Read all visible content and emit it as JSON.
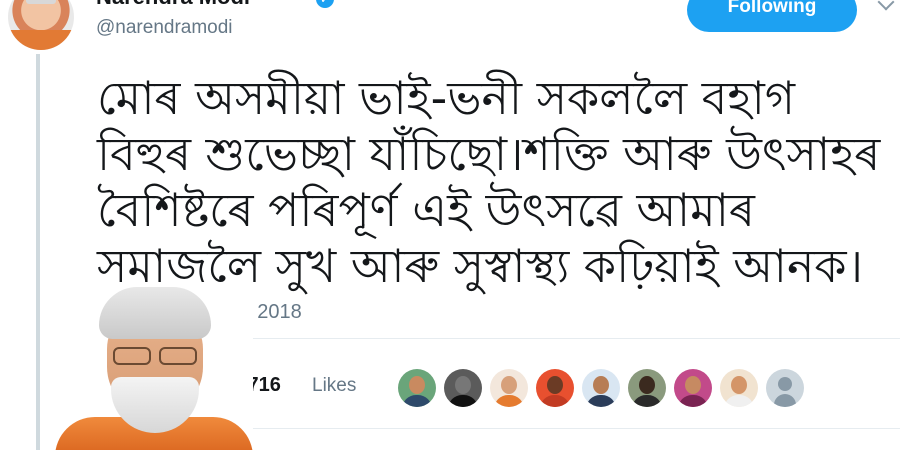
{
  "header": {
    "display_name": "Narendra Modi",
    "handle": "@narendramodi",
    "follow_button_label": "Following",
    "verified_icon": "check-icon"
  },
  "tweet": {
    "text": "মোৰ অসমীয়া ভাই-ভনী সকললৈ বহাগ\nবিহুৰ শুভেচ্ছা যাঁচিছো।শক্তি আৰু উৎসাহৰ\nবৈশিষ্টৰে পৰিপূৰ্ণ এই উৎসৱে আমাৰ\nসমাজলৈ সুখ আৰু সুস্বাস্থ্য কঢ়িয়াই আনক।",
    "timestamp_fragment": "r 2018"
  },
  "engagement": {
    "likes_count_fragment": ",716",
    "likes_label": "Likes",
    "liker_avatars": 10
  },
  "colors": {
    "accent": "#1da1f2",
    "secondary_text": "#657786",
    "divider": "#e6ecf0"
  }
}
